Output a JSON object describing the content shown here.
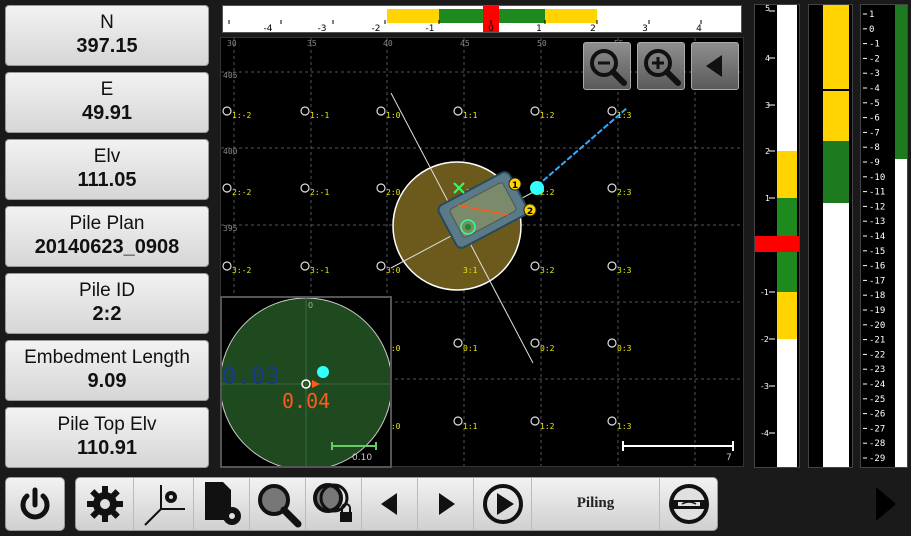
{
  "info_panels": [
    {
      "label": "N",
      "value": "397.15"
    },
    {
      "label": "E",
      "value": "49.91"
    },
    {
      "label": "Elv",
      "value": "111.05"
    },
    {
      "label": "Pile Plan",
      "value": "20140623_0908"
    },
    {
      "label": "Pile ID",
      "value": "2:2"
    },
    {
      "label": "Embedment Length",
      "value": "9.09"
    },
    {
      "label": "Pile Top Elv",
      "value": "110.91"
    }
  ],
  "top_scale": {
    "ticks": [
      "-4",
      "-3",
      "-2",
      "-1",
      "0",
      "1",
      "2",
      "3",
      "4"
    ],
    "indicator_value": 0
  },
  "map": {
    "x_grid_labels": [
      "30",
      "35",
      "40",
      "45",
      "50",
      "55"
    ],
    "y_grid_labels": [
      "405",
      "400",
      "395"
    ],
    "pile_labels": [
      "1:-2",
      "1:-1",
      "1:0",
      "1:1",
      "1:2",
      "1:3",
      "2:-2",
      "2:-1",
      "2:0",
      "2:1",
      "2:2",
      "2:3",
      "3:-2",
      "3:-1",
      "3:0",
      "3:1",
      "3:2",
      "3:3",
      "0:0",
      "0:1",
      "0:2",
      "0:3",
      "1:0",
      "1:1",
      "1:2",
      "1:3"
    ],
    "markers": [
      "1",
      "2"
    ],
    "scale_label": "7"
  },
  "inset": {
    "value_blue": "0.03",
    "value_orange": "0.04",
    "zero_label": "0",
    "scale_label": "0.10"
  },
  "vertical_scale": {
    "ticks": [
      "5",
      "4",
      "3",
      "2",
      "1",
      "0",
      "-1",
      "-2",
      "-3",
      "-4"
    ]
  },
  "depth_scale": {
    "ticks": [
      "1",
      "0",
      "-1",
      "-2",
      "-3",
      "-4",
      "-5",
      "-6",
      "-7",
      "-8",
      "-9",
      "-10",
      "-11",
      "-12",
      "-13",
      "-14",
      "-15",
      "-16",
      "-17",
      "-18",
      "-19",
      "-20",
      "-21",
      "-22",
      "-23",
      "-24",
      "-25",
      "-26",
      "-27",
      "-28",
      "-29"
    ]
  },
  "toolbar": {
    "piling_label": "Piling"
  },
  "icons": {
    "power": "power-icon",
    "settings": "gear-icon",
    "axes": "axes-gear-icon",
    "file_settings": "file-gear-icon",
    "search": "magnifier-icon",
    "search_lock": "magnifier-lock-icon",
    "prev": "triangle-left-icon",
    "next": "triangle-right-icon",
    "play": "play-circle-icon",
    "level": "level-icon",
    "zoom_out": "zoom-out-icon",
    "zoom_in": "zoom-in-icon",
    "collapse": "triangle-left-icon"
  },
  "colors": {
    "yellow": "#ffd400",
    "green": "#1e7a1e",
    "red": "#ff0000",
    "cyan": "#33ffff",
    "orange": "#ff5a1a",
    "olive_fill": "#6b5a1c"
  }
}
